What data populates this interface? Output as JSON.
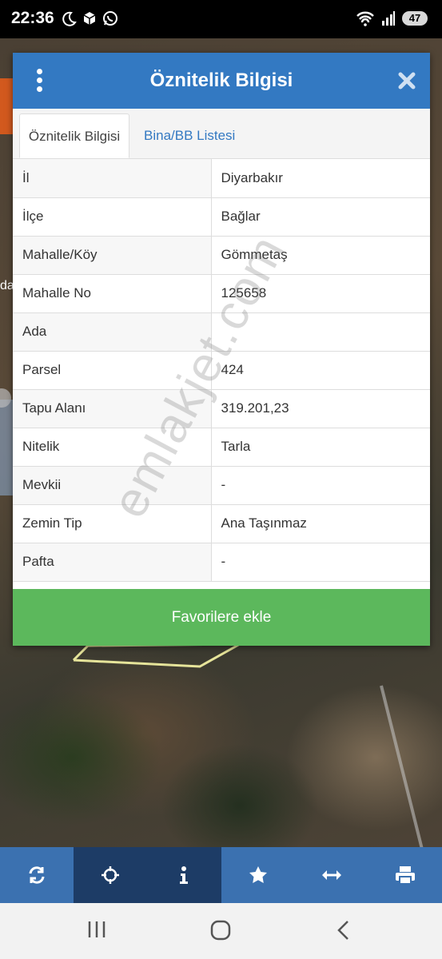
{
  "status_bar": {
    "time": "22:36",
    "battery": "47",
    "icons": [
      "moon-icon",
      "package-icon",
      "whatsapp-icon",
      "wifi-icon",
      "signal-icon"
    ]
  },
  "dialog": {
    "title": "Öznitelik Bilgisi",
    "tabs": [
      {
        "label": "Öznitelik Bilgisi",
        "active": true
      },
      {
        "label": "Bina/BB Listesi",
        "active": false
      }
    ],
    "rows": [
      {
        "key": "İl",
        "value": "Diyarbakır"
      },
      {
        "key": "İlçe",
        "value": "Bağlar"
      },
      {
        "key": "Mahalle/Köy",
        "value": "Gömmetaş"
      },
      {
        "key": "Mahalle No",
        "value": "125658"
      },
      {
        "key": "Ada",
        "value": ""
      },
      {
        "key": "Parsel",
        "value": "424"
      },
      {
        "key": "Tapu Alanı",
        "value": "319.201,23"
      },
      {
        "key": "Nitelik",
        "value": "Tarla"
      },
      {
        "key": "Mevkii",
        "value": "-"
      },
      {
        "key": "Zemin Tip",
        "value": "Ana Taşınmaz"
      },
      {
        "key": "Pafta",
        "value": "-"
      }
    ],
    "favorite_button": "Favorilere ekle"
  },
  "watermark": "emlakjet.com",
  "toolbar": {
    "items": [
      "refresh-icon",
      "locate-icon",
      "info-icon",
      "star-icon",
      "measure-icon",
      "print-icon"
    ],
    "active": "info-icon"
  },
  "colors": {
    "header_blue": "#3379c2",
    "favorite_green": "#5cb85c",
    "toolbar_blue": "#3b71b0"
  }
}
